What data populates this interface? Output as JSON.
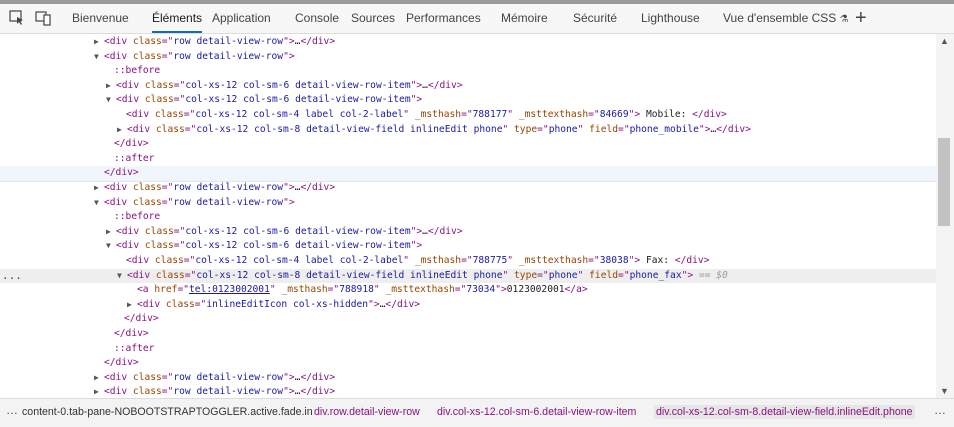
{
  "tabs": [
    {
      "label": "Bienvenue"
    },
    {
      "label": "Éléments"
    },
    {
      "label": "Application"
    },
    {
      "label": "Console"
    },
    {
      "label": "Sources"
    },
    {
      "label": "Performances"
    },
    {
      "label": "Mémoire"
    },
    {
      "label": "Sécurité"
    },
    {
      "label": "Lighthouse"
    },
    {
      "label": "Vue d'ensemble CSS"
    }
  ],
  "tree": {
    "row": "row detail-view-row",
    "item": "col-xs-12 col-sm-6 detail-view-row-item",
    "label_class": "col-xs-12 col-sm-4 label col-2-label",
    "field_class": "col-xs-12 col-sm-8 detail-view-field inlineEdit phone",
    "msthash1": "788177",
    "msttexthash1": "84669",
    "mobile_text": " Mobile: ",
    "phone_type": "phone",
    "field_mobile": "phone_mobile",
    "msthash2": "788775",
    "msttexthash2": "38038",
    "fax_text": " Fax: ",
    "field_fax": "phone_fax",
    "dollar": "== $0",
    "href": "tel:0123002001",
    "msthash3": "788918",
    "msttexthash3": "73034",
    "phone_number": "0123002001",
    "inline_icon_class": "inlineEditIcon col-xs-hidden",
    "before": "::before",
    "after": "::after",
    "ellipsis": "…"
  },
  "breadcrumbs": [
    {
      "label": "content-0.tab-pane-NOBOOTSTRAPTOGGLER.active.fade.in"
    },
    {
      "label": "div.row.detail-view-row"
    },
    {
      "label": "div.col-xs-12.col-sm-6.detail-view-row-item"
    },
    {
      "label": "div.col-xs-12.col-sm-8.detail-view-field.inlineEdit.phone"
    }
  ],
  "icons": {
    "inspect": "inspect-icon",
    "device": "device-emulation-icon",
    "beaker": "experiment-icon",
    "plus": "add-tab-icon"
  }
}
